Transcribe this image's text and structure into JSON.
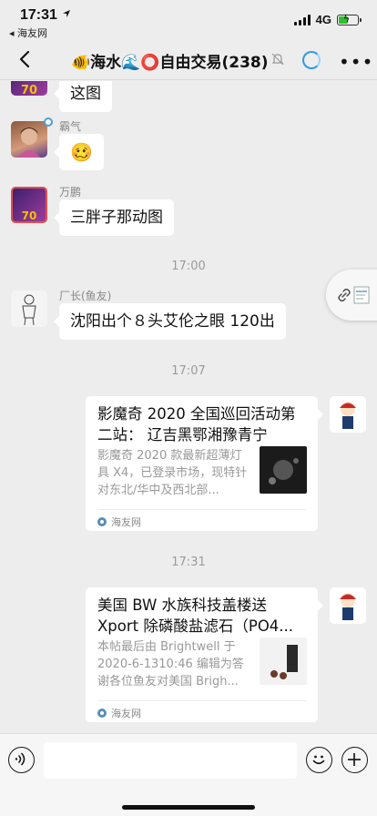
{
  "status_bar": {
    "time": "17:31",
    "back_app": "◂ 海友网",
    "network": "4G",
    "battery_level": 0.5
  },
  "nav": {
    "title": "🐠海水🌊⭕自由交易(238)",
    "mute_icon": "bell-off-icon",
    "ring_icon": "loading-ring-icon",
    "more_label": "•••"
  },
  "messages": [
    {
      "sender": "",
      "text": "这图"
    },
    {
      "sender": "霸气",
      "sticker": "🥴"
    },
    {
      "sender": "万鹏",
      "text": "三胖子那动图"
    },
    {
      "sender": "厂长(鱼友)",
      "text": "沈阳出个８头艾伦之眼 120出"
    }
  ],
  "timestamps": [
    "17:00",
    "17:07",
    "17:31"
  ],
  "cards": [
    {
      "title": "影魔奇 2020 全国巡回活动第二站： 辽吉黑鄂湘豫青宁",
      "desc": "影魔奇 2020 款最新超薄灯具 X4，已登录市场，现特针对东北/华中及西北部...",
      "source": "海友网"
    },
    {
      "title": "美国 BW 水族科技盖楼送 Xport 除磷酸盐滤石（PO4...",
      "desc": "本帖最后由 Brightwell 于 2020-6-1310:46 编辑为答谢各位鱼友对美国 Brigh...",
      "source": "海友网"
    }
  ],
  "colors": {
    "background": "#ededed",
    "bubble": "#ffffff",
    "accent": "#2e9ae0",
    "source_icon": "#5b8fb3"
  },
  "input_bar": {
    "placeholder": "",
    "voice_icon": "voice-icon",
    "emoji_icon": "emoji-icon",
    "plus_icon": "plus-icon"
  }
}
